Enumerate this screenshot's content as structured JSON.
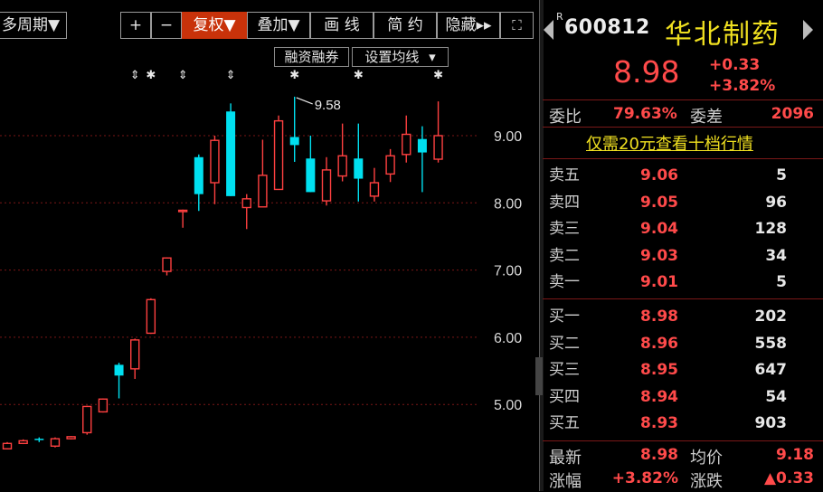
{
  "toolbar": {
    "period": "多周期▼",
    "zoom_in": "+",
    "zoom_out": "−",
    "adjust": "复权▼",
    "overlay": "叠加▼",
    "draw": "画 线",
    "simple": "简 约",
    "hide": "隐藏▸▸",
    "fullscreen": "⛶",
    "margin_trading": "融资融券",
    "ma_settings": "设置均线",
    "ma_arrow": "▾"
  },
  "quote": {
    "r_badge": "R",
    "code": "600812",
    "name": "华北制药",
    "price": "8.98",
    "change": "+0.33",
    "change_pct": "+3.82%",
    "ratio_label": "委比",
    "ratio_value": "79.63%",
    "diff_label": "委差",
    "diff_value": "2096",
    "tenlevel_link": "仅需20元查看十档行情",
    "asks": [
      {
        "label": "卖五",
        "price": "9.06",
        "vol": "5"
      },
      {
        "label": "卖四",
        "price": "9.05",
        "vol": "96"
      },
      {
        "label": "卖三",
        "price": "9.04",
        "vol": "128"
      },
      {
        "label": "卖二",
        "price": "9.03",
        "vol": "34"
      },
      {
        "label": "卖一",
        "price": "9.01",
        "vol": "5"
      }
    ],
    "bids": [
      {
        "label": "买一",
        "price": "8.98",
        "vol": "202"
      },
      {
        "label": "买二",
        "price": "8.96",
        "vol": "558"
      },
      {
        "label": "买三",
        "price": "8.95",
        "vol": "647"
      },
      {
        "label": "买四",
        "price": "8.94",
        "vol": "54"
      },
      {
        "label": "买五",
        "price": "8.93",
        "vol": "903"
      }
    ],
    "latest_label": "最新",
    "latest_value": "8.98",
    "avg_label": "均价",
    "avg_value": "9.18",
    "pct_label": "涨幅",
    "pct_value": "+3.82%",
    "updown_label": "涨跌",
    "updown_value": "▲0.33"
  },
  "colors": {
    "up": "#ff4040",
    "down": "#00e0f0",
    "grid": "#7a1616",
    "axis_text": "#d8d8d8",
    "active": "#c8320a"
  },
  "chart_data": {
    "type": "candlestick",
    "ylim": [
      4.3,
      9.85
    ],
    "yticks": [
      "9.00",
      "8.00",
      "7.00",
      "6.00",
      "5.00"
    ],
    "max_label": "9.58",
    "candles": [
      {
        "o": 4.34,
        "c": 4.42,
        "h": 4.44,
        "l": 4.33
      },
      {
        "o": 4.42,
        "c": 4.46,
        "h": 4.48,
        "l": 4.41
      },
      {
        "o": 4.49,
        "c": 4.47,
        "h": 4.51,
        "l": 4.44
      },
      {
        "o": 4.38,
        "c": 4.49,
        "h": 4.51,
        "l": 4.36
      },
      {
        "o": 4.49,
        "c": 4.52,
        "h": 4.53,
        "l": 4.48
      },
      {
        "o": 4.58,
        "c": 4.97,
        "h": 4.98,
        "l": 4.55
      },
      {
        "o": 4.89,
        "c": 5.08,
        "h": 5.09,
        "l": 4.88
      },
      {
        "o": 5.59,
        "c": 5.43,
        "h": 5.62,
        "l": 5.09
      },
      {
        "o": 5.53,
        "c": 5.96,
        "h": 5.98,
        "l": 5.38
      },
      {
        "o": 6.06,
        "c": 6.56,
        "h": 6.58,
        "l": 6.05
      },
      {
        "o": 6.98,
        "c": 7.18,
        "h": 7.19,
        "l": 6.92
      },
      {
        "o": 7.88,
        "c": 7.89,
        "h": 7.9,
        "l": 7.63
      },
      {
        "o": 8.68,
        "c": 8.13,
        "h": 8.72,
        "l": 7.88
      },
      {
        "o": 8.3,
        "c": 8.93,
        "h": 9.0,
        "l": 7.98
      },
      {
        "o": 9.36,
        "c": 8.1,
        "h": 9.48,
        "l": 8.1
      },
      {
        "o": 7.93,
        "c": 8.06,
        "h": 8.13,
        "l": 7.61
      },
      {
        "o": 7.94,
        "c": 8.41,
        "h": 8.94,
        "l": 7.94
      },
      {
        "o": 8.2,
        "c": 9.22,
        "h": 9.3,
        "l": 8.2
      },
      {
        "o": 8.98,
        "c": 8.86,
        "h": 9.58,
        "l": 8.61
      },
      {
        "o": 8.66,
        "c": 8.16,
        "h": 9.0,
        "l": 8.16
      },
      {
        "o": 8.03,
        "c": 8.49,
        "h": 8.68,
        "l": 7.96
      },
      {
        "o": 8.4,
        "c": 8.7,
        "h": 9.18,
        "l": 8.32
      },
      {
        "o": 8.66,
        "c": 8.36,
        "h": 9.18,
        "l": 8.02
      },
      {
        "o": 8.1,
        "c": 8.3,
        "h": 8.52,
        "l": 8.02
      },
      {
        "o": 8.43,
        "c": 8.7,
        "h": 8.8,
        "l": 8.31
      },
      {
        "o": 8.72,
        "c": 9.02,
        "h": 9.3,
        "l": 8.6
      },
      {
        "o": 8.95,
        "c": 8.75,
        "h": 9.14,
        "l": 8.16
      },
      {
        "o": 8.65,
        "c": 9.0,
        "h": 9.51,
        "l": 8.6
      }
    ],
    "markers": [
      {
        "i": 8,
        "sym": "⇕"
      },
      {
        "i": 9,
        "sym": "✱"
      },
      {
        "i": 11,
        "sym": "⇕"
      },
      {
        "i": 14,
        "sym": "⇕"
      },
      {
        "i": 18,
        "sym": "✱"
      },
      {
        "i": 22,
        "sym": "✱"
      },
      {
        "i": 27,
        "sym": "✱"
      }
    ]
  }
}
